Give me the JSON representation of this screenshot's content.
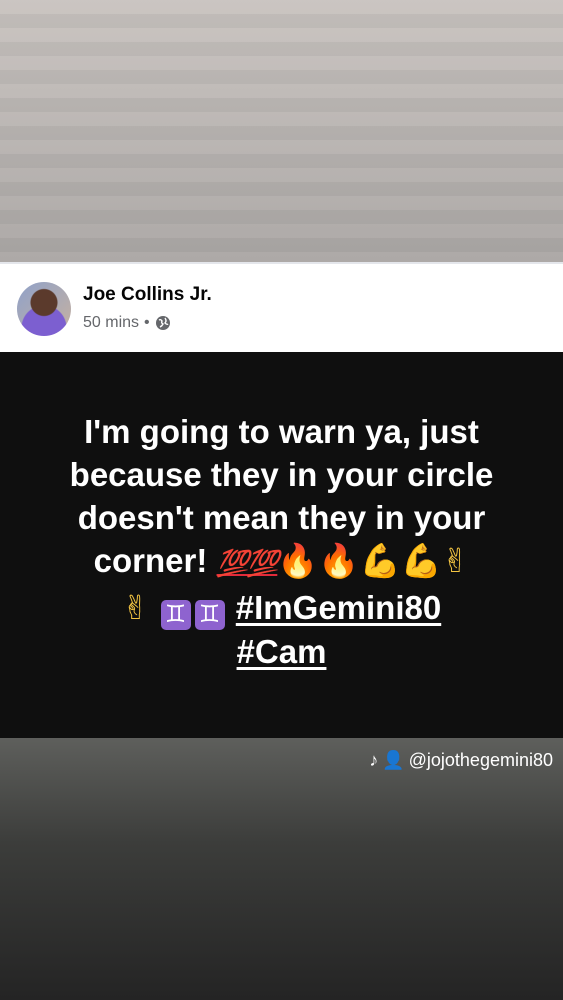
{
  "post": {
    "author": "Joe Collins Jr.",
    "time": "50 mins",
    "separator": "•",
    "privacy_icon": "globe-icon"
  },
  "content": {
    "line1": "I'm going to warn ya, just because they in your circle doesn't mean they in your corner!",
    "emoji_100": "💯💯",
    "emoji_fire": "🔥🔥",
    "emoji_muscle": "💪💪",
    "emoji_peace": "✌",
    "emoji_peace2": "✌",
    "emoji_gemini": "♊",
    "hashtag1": "#ImGemini80",
    "hashtag2": "#Cam"
  },
  "watermark": {
    "icons": [
      "tiktok-icon",
      "person-icon"
    ],
    "handle": "@jojothegemini80"
  },
  "colors": {
    "content_bg": "#0f0f0f",
    "header_bg": "#ffffff",
    "meta_text": "#65676b"
  }
}
